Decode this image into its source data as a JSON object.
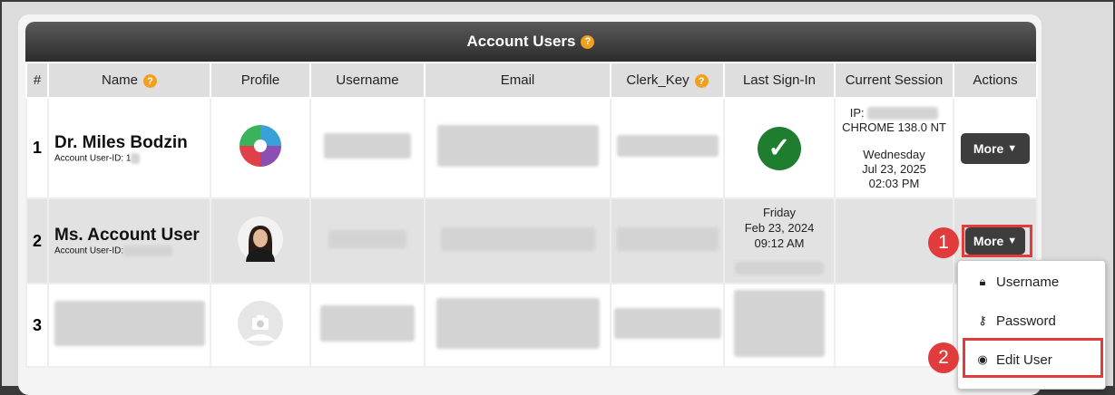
{
  "title": "Account Users",
  "help_symbol": "?",
  "columns": {
    "num": "#",
    "name": "Name",
    "profile": "Profile",
    "username": "Username",
    "email": "Email",
    "clerk_key": "Clerk_Key",
    "last_signin": "Last Sign-In",
    "current_session": "Current Session",
    "actions": "Actions"
  },
  "rows": [
    {
      "num": "1",
      "name": "Dr. Miles Bodzin",
      "user_id_label": "Account User-ID: 1",
      "profile_icon": "puzzle-logo-icon",
      "last_signin_icon": "check-icon",
      "session": {
        "ip_label": "IP:",
        "browser": "CHROME 138.0 NT",
        "day": "Wednesday",
        "date": "Jul 23, 2025",
        "time": "02:03 PM"
      },
      "action_label": "More"
    },
    {
      "num": "2",
      "name": "Ms. Account User",
      "user_id_label": "Account User-ID:",
      "profile_icon": "user-photo-avatar",
      "last_signin": {
        "day": "Friday",
        "date": "Feb 23, 2024",
        "time": "09:12 AM"
      },
      "action_label": "More"
    },
    {
      "num": "3",
      "profile_icon": "camera-placeholder-icon"
    }
  ],
  "dropdown": {
    "items": [
      {
        "label": "Username",
        "icon": "lock-icon"
      },
      {
        "label": "Password",
        "icon": "key-icon"
      },
      {
        "label": "Edit User",
        "icon": "user-circle-icon"
      }
    ]
  },
  "annotations": [
    "1",
    "2"
  ],
  "colors": {
    "highlight": "#e23b3b",
    "help": "#f0a020",
    "button": "#3d3d3d",
    "success": "#1e7d2e"
  }
}
